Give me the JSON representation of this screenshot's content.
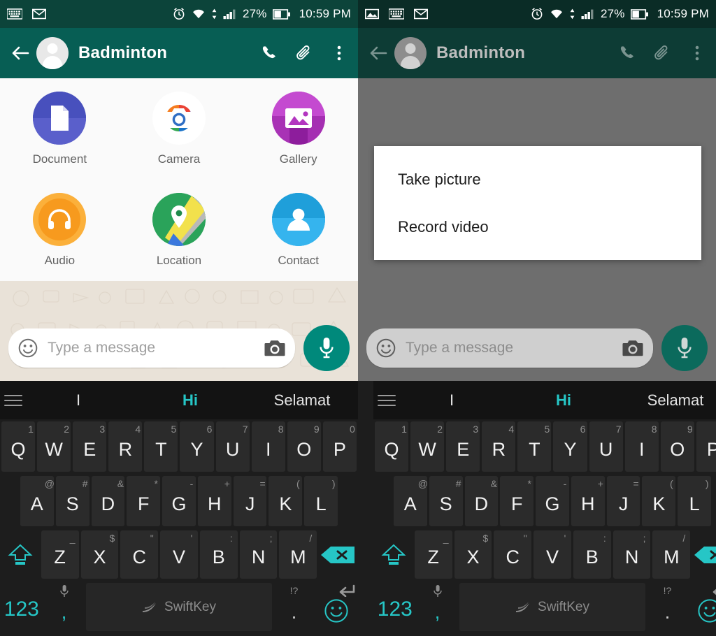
{
  "panels": [
    {
      "id": "left",
      "statusbar": {
        "icons": [
          "keyboard-icon",
          "gmail-icon"
        ],
        "alarm_icon": "alarm-icon",
        "wifi_icon": "wifi-icon",
        "signal_icon": "cell-signal-icon",
        "battery_percent": "27%",
        "battery_icon": "battery-icon",
        "time": "10:59 PM"
      },
      "appbar": {
        "back": "back-arrow-icon",
        "title": "Badminton",
        "call": "phone-icon",
        "attach": "paperclip-icon",
        "overflow": "more-vertical-icon"
      },
      "attachments": [
        {
          "label": "Document",
          "icon": "document-icon"
        },
        {
          "label": "Camera",
          "icon": "camera-icon"
        },
        {
          "label": "Gallery",
          "icon": "gallery-icon"
        },
        {
          "label": "Audio",
          "icon": "audio-icon"
        },
        {
          "label": "Location",
          "icon": "location-icon"
        },
        {
          "label": "Contact",
          "icon": "contact-icon"
        }
      ],
      "input": {
        "placeholder": "Type a message",
        "emoji_icon": "smiley-icon",
        "camera_icon": "camera-icon",
        "mic_icon": "microphone-icon"
      },
      "dialog": null
    },
    {
      "id": "right",
      "statusbar": {
        "icons": [
          "screenshot-icon",
          "keyboard-icon",
          "gmail-icon"
        ],
        "alarm_icon": "alarm-icon",
        "wifi_icon": "wifi-icon",
        "signal_icon": "cell-signal-icon",
        "battery_percent": "27%",
        "battery_icon": "battery-icon",
        "time": "10:59 PM"
      },
      "appbar": {
        "back": "back-arrow-icon",
        "title": "Badminton",
        "call": "phone-icon",
        "attach": "paperclip-icon",
        "overflow": "more-vertical-icon"
      },
      "input": {
        "placeholder": "Type a message",
        "emoji_icon": "smiley-icon",
        "camera_icon": "camera-icon",
        "mic_icon": "microphone-icon"
      },
      "dialog": {
        "items": [
          "Take picture",
          "Record video"
        ]
      }
    }
  ],
  "keyboard": {
    "menu_icon": "hamburger-menu-icon",
    "suggestions": [
      {
        "text": "I",
        "highlighted": false
      },
      {
        "text": "Hi",
        "highlighted": true
      },
      {
        "text": "Selamat",
        "highlighted": false
      }
    ],
    "row1": [
      {
        "key": "Q",
        "hint": "1"
      },
      {
        "key": "W",
        "hint": "2"
      },
      {
        "key": "E",
        "hint": "3"
      },
      {
        "key": "R",
        "hint": "4"
      },
      {
        "key": "T",
        "hint": "5"
      },
      {
        "key": "Y",
        "hint": "6"
      },
      {
        "key": "U",
        "hint": "7"
      },
      {
        "key": "I",
        "hint": "8"
      },
      {
        "key": "O",
        "hint": "9"
      },
      {
        "key": "P",
        "hint": "0"
      }
    ],
    "row2": [
      {
        "key": "A",
        "hint": "@"
      },
      {
        "key": "S",
        "hint": "#"
      },
      {
        "key": "D",
        "hint": "&"
      },
      {
        "key": "F",
        "hint": "*"
      },
      {
        "key": "G",
        "hint": "-"
      },
      {
        "key": "H",
        "hint": "+"
      },
      {
        "key": "J",
        "hint": "="
      },
      {
        "key": "K",
        "hint": "("
      },
      {
        "key": "L",
        "hint": ")"
      }
    ],
    "row3": {
      "shift_icon": "shift-key-icon",
      "keys": [
        {
          "key": "Z",
          "hint": "_"
        },
        {
          "key": "X",
          "hint": "$"
        },
        {
          "key": "C",
          "hint": "\""
        },
        {
          "key": "V",
          "hint": "'"
        },
        {
          "key": "B",
          "hint": ":"
        },
        {
          "key": "N",
          "hint": ";"
        },
        {
          "key": "M",
          "hint": "/"
        }
      ],
      "backspace_icon": "backspace-key-icon"
    },
    "row4": {
      "numeric": "123",
      "comma": ",",
      "comma_hint_icon": "microphone-icon",
      "space_label": "SwiftKey",
      "space_logo_icon": "swiftkey-logo-icon",
      "period": ".",
      "period_hint": "!?",
      "emoji_icon": "smiley-key-icon",
      "enter_hint_icon": "enter-key-icon"
    }
  },
  "colors": {
    "whatsapp_teal": "#075e54",
    "accent_teal": "#26c6c6",
    "fab_green": "#00897b",
    "wallpaper": "#e9e2d8",
    "keyboard_bg": "#1d1d1d"
  }
}
